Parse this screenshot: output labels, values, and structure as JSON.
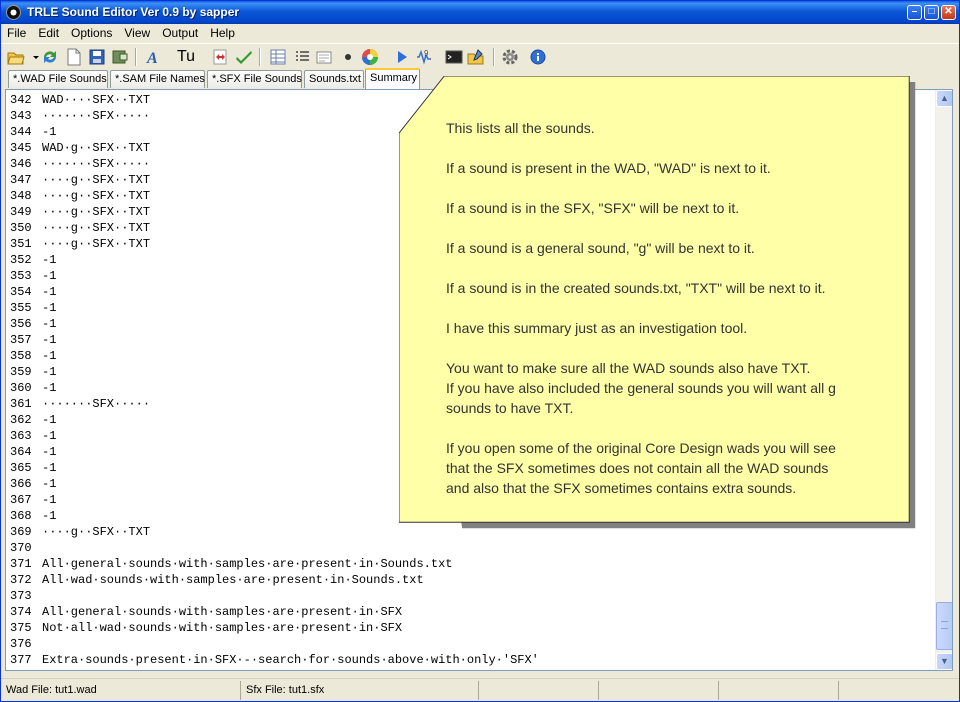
{
  "window": {
    "title": "TRLE Sound Editor Ver 0.9 by sapper"
  },
  "menu": [
    "File",
    "Edit",
    "Options",
    "View",
    "Output",
    "Help"
  ],
  "toolbar": {
    "font_label": "Tu"
  },
  "tabs": [
    {
      "label": "*.WAD File Sounds",
      "active": false
    },
    {
      "label": "*.SAM File Names",
      "active": false
    },
    {
      "label": "*.SFX File Sounds",
      "active": false
    },
    {
      "label": "Sounds.txt",
      "active": false
    },
    {
      "label": "Summary",
      "active": true
    }
  ],
  "editor": {
    "lines": [
      {
        "n": "342",
        "t": "WAD····SFX··TXT"
      },
      {
        "n": "343",
        "t": "·······SFX·····"
      },
      {
        "n": "344",
        "t": "-1"
      },
      {
        "n": "345",
        "t": "WAD·g··SFX··TXT"
      },
      {
        "n": "346",
        "t": "·······SFX·····"
      },
      {
        "n": "347",
        "t": "····g··SFX··TXT"
      },
      {
        "n": "348",
        "t": "····g··SFX··TXT"
      },
      {
        "n": "349",
        "t": "····g··SFX··TXT"
      },
      {
        "n": "350",
        "t": "····g··SFX··TXT"
      },
      {
        "n": "351",
        "t": "····g··SFX··TXT"
      },
      {
        "n": "352",
        "t": "-1"
      },
      {
        "n": "353",
        "t": "-1"
      },
      {
        "n": "354",
        "t": "-1"
      },
      {
        "n": "355",
        "t": "-1"
      },
      {
        "n": "356",
        "t": "-1"
      },
      {
        "n": "357",
        "t": "-1"
      },
      {
        "n": "358",
        "t": "-1"
      },
      {
        "n": "359",
        "t": "-1"
      },
      {
        "n": "360",
        "t": "-1"
      },
      {
        "n": "361",
        "t": "·······SFX·····"
      },
      {
        "n": "362",
        "t": "-1"
      },
      {
        "n": "363",
        "t": "-1"
      },
      {
        "n": "364",
        "t": "-1"
      },
      {
        "n": "365",
        "t": "-1"
      },
      {
        "n": "366",
        "t": "-1"
      },
      {
        "n": "367",
        "t": "-1"
      },
      {
        "n": "368",
        "t": "-1"
      },
      {
        "n": "369",
        "t": "····g··SFX··TXT"
      },
      {
        "n": "370",
        "t": ""
      },
      {
        "n": "371",
        "t": "All·general·sounds·with·samples·are·present·in·Sounds.txt"
      },
      {
        "n": "372",
        "t": "All·wad·sounds·with·samples·are·present·in·Sounds.txt"
      },
      {
        "n": "373",
        "t": ""
      },
      {
        "n": "374",
        "t": "All·general·sounds·with·samples·are·present·in·SFX"
      },
      {
        "n": "375",
        "t": "Not·all·wad·sounds·with·samples·are·present·in·SFX"
      },
      {
        "n": "376",
        "t": ""
      },
      {
        "n": "377",
        "t": "Extra·sounds·present·in·SFX·-·search·for·sounds·above·with·only·'SFX'"
      }
    ]
  },
  "note": {
    "paragraphs": [
      "This lists all the sounds.",
      "If a sound is present in the WAD, \"WAD\" is next to it.",
      "If a sound is in the SFX, \"SFX\" will be next to it.",
      "If a sound is a general sound, \"g\" will be next to it.",
      "If a sound is in the created sounds.txt, \"TXT\" will be next to it.",
      "I have this summary just as an investigation tool.",
      "You want to make sure all the WAD sounds also have TXT.\nIf you have also included the general sounds you will want all g\nsounds to have TXT.",
      "If you open some of the original Core Design wads you will see\nthat the SFX sometimes does not contain all the WAD sounds\nand also that the SFX sometimes contains extra sounds."
    ],
    "fill": "#ffffa8",
    "shadow": "#808080"
  },
  "status": {
    "wad": "Wad File: tut1.wad",
    "sfx": "Sfx File: tut1.sfx"
  }
}
